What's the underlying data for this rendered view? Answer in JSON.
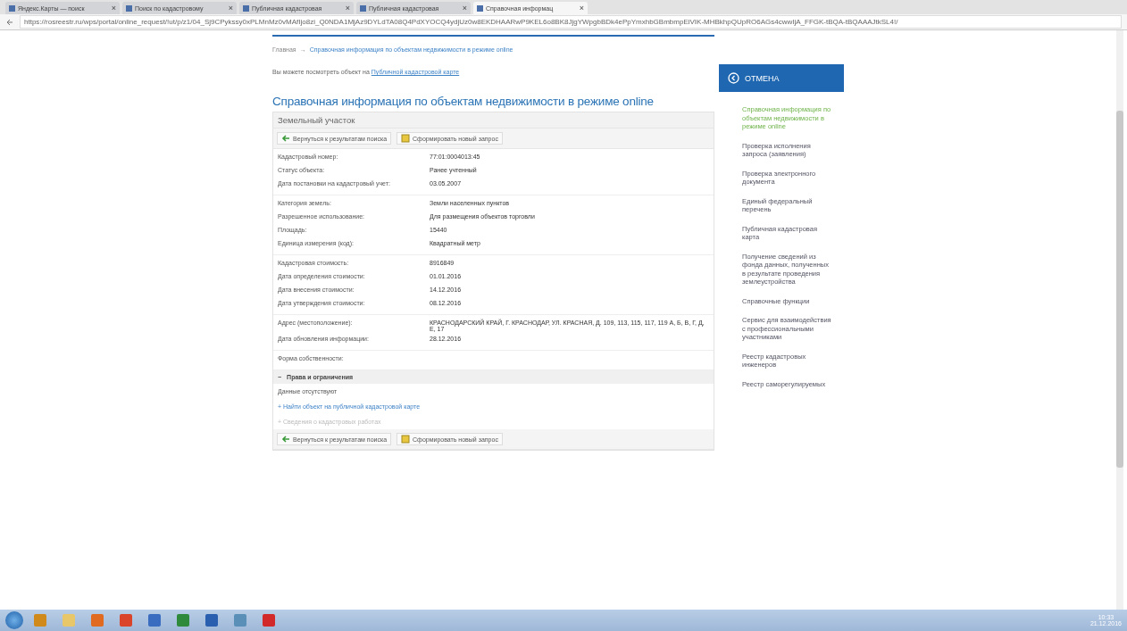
{
  "browser": {
    "tabs": [
      {
        "title": "Яндекс.Карты — поиск",
        "close": "×",
        "selected": false
      },
      {
        "title": "Поиск по кадастровому",
        "close": "×",
        "selected": false
      },
      {
        "title": "Публичная кадастровая",
        "close": "×",
        "selected": false
      },
      {
        "title": "Публичная кадастровая",
        "close": "×",
        "selected": false
      },
      {
        "title": "Справочная информац",
        "close": "×",
        "selected": true
      }
    ],
    "address": "https://rosreestr.ru/wps/portal/online_request/!ut/p/z1/04_Sj9CPykssy0xPLMnMz0vMAfIjo8zi_Q0NDA1MjAz9DYLdTA08Q4PdXYOCQ4ydjUz0w8EKDHAARwP9KEL6o8BK8JjgYWpgbBDk4ePpYmxhbGBmbmpEiVIK-MHBkhpQUpRO6AGs4cwwIjA_FFGK-tBQA-tBQAAAJtkSL4!/"
  },
  "breadcrumb": {
    "home": "Главная",
    "separator": "→",
    "current": "Справочная информация по объектам недвижимости в режиме online"
  },
  "map_note": {
    "text": "Вы можете посмотреть объект на ",
    "link": "Публичной кадастровой карте"
  },
  "title": "Справочная информация по объектам недвижимости в режиме online",
  "panel": {
    "header": "Земельный участок",
    "top_actions": [
      {
        "kind": "back",
        "text": "Вернуться к результатам поиска"
      },
      {
        "kind": "new",
        "text": "Сформировать новый запрос"
      }
    ],
    "groups": [
      [
        {
          "label": "Кадастровый номер:",
          "value": "77:01:0004013:45"
        },
        {
          "label": "Статус объекта:",
          "value": "Ранее учтенный"
        },
        {
          "label": "Дата постановки на кадастровый учет:",
          "value": "03.05.2007"
        }
      ],
      [
        {
          "label": "Категория земель:",
          "value": "Земли населенных пунктов"
        },
        {
          "label": "Разрешенное использование:",
          "value": "Для размещения объектов торговли"
        },
        {
          "label": "Площадь:",
          "value": "15440"
        },
        {
          "label": "Единица измерения (код):",
          "value": "Квадратный метр"
        }
      ],
      [
        {
          "label": "Кадастровая стоимость:",
          "value": "8916849"
        },
        {
          "label": "Дата определения стоимости:",
          "value": "01.01.2016"
        },
        {
          "label": "Дата внесения стоимости:",
          "value": "14.12.2016"
        },
        {
          "label": "Дата утверждения стоимости:",
          "value": "08.12.2016"
        }
      ],
      [
        {
          "label": "Адрес (местоположение):",
          "value": "КРАСНОДАРСКИЙ КРАЙ, Г. КРАСНОДАР, УЛ. КРАСНАЯ, Д. 109, 113, 115, 117, 119 А, Б, В, Г, Д, Е, 17"
        },
        {
          "label": "Дата обновления информации:",
          "value": "28.12.2016"
        }
      ],
      [
        {
          "label": "Форма собственности:"
        }
      ]
    ],
    "rights": {
      "toggle": "−",
      "title": "Права и ограничения",
      "expanded": true,
      "empty": "Данные отсутствуют"
    },
    "links": [
      {
        "sign": "+",
        "text": "Найти объект на публичной кадастровой карте",
        "disabled": false
      },
      {
        "sign": "+",
        "text": "Сведения о кадастровых работах",
        "disabled": true
      }
    ],
    "bottom_actions": [
      {
        "kind": "back",
        "text": "Вернуться к результатам поиска"
      },
      {
        "kind": "new",
        "text": "Сформировать новый запрос"
      }
    ]
  },
  "sidebar": {
    "header": "ОТМЕНА",
    "items": [
      {
        "text": "Справочная информация по объектам недвижимости в режиме online",
        "selected": true
      },
      {
        "text": "Проверка исполнения запроса (заявления)",
        "selected": false
      },
      {
        "text": "Проверка электронного документа",
        "selected": false
      },
      {
        "text": "Единый федеральный перечень",
        "selected": false
      },
      {
        "text": "Публичная кадастровая карта",
        "selected": false
      },
      {
        "text": "Получение сведений из фонда данных, полученных в результате проведения землеустройства",
        "selected": false
      },
      {
        "text": "Справочные функции",
        "selected": false
      },
      {
        "text": "Сервис для взаимодействия с профессиональными участниками",
        "selected": false
      },
      {
        "text": "Реестр кадастровых инженеров",
        "selected": false
      },
      {
        "text": "Реестр саморегулируемых",
        "selected": false
      }
    ]
  },
  "taskbar": {
    "time": "10:33",
    "date": "21.12.2016",
    "apps": [
      {
        "kind": "media"
      },
      {
        "kind": "folder"
      },
      {
        "kind": "player"
      },
      {
        "kind": "chrome"
      },
      {
        "kind": "doc"
      },
      {
        "kind": "excel"
      },
      {
        "kind": "word"
      },
      {
        "kind": "image"
      },
      {
        "kind": "pdf"
      }
    ]
  }
}
